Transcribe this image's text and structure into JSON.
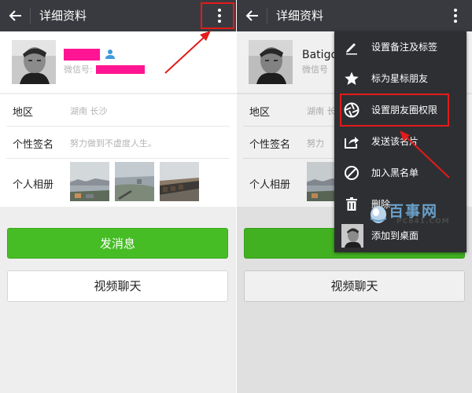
{
  "header": {
    "title": "详细资料"
  },
  "left_profile": {
    "wechat_id_label": "微信号:"
  },
  "right_profile": {
    "name_partial": "Batigo",
    "wechat_id_label": "微信号"
  },
  "info": {
    "region_label": "地区",
    "region_value": "湖南  长沙",
    "region_value_partial": "湖南  长",
    "signature_label": "个性签名",
    "signature_value": "努力做到不虚度人生。",
    "signature_value_partial": "努力",
    "album_label": "个人相册"
  },
  "buttons": {
    "send_message": "发消息",
    "video_chat": "视频聊天"
  },
  "menu": {
    "items": [
      {
        "label": "设置备注及标签",
        "icon": "pencil-icon"
      },
      {
        "label": "标为星标朋友",
        "icon": "star-icon"
      },
      {
        "label": "设置朋友圈权限",
        "icon": "aperture-icon"
      },
      {
        "label": "发送该名片",
        "icon": "share-icon"
      },
      {
        "label": "加入黑名单",
        "icon": "block-icon"
      },
      {
        "label": "删除",
        "icon": "trash-icon"
      },
      {
        "label": "添加到桌面",
        "icon": "avatar-icon"
      }
    ]
  },
  "watermark": {
    "title": "百事网",
    "subtitle": "PC841.COM"
  },
  "colors": {
    "topbar": "#393a3f",
    "accent_green": "#46bd24",
    "menu_bg": "#2e2f33",
    "annotation_red": "#e31b1b",
    "redaction_pink": "#ff1493"
  }
}
